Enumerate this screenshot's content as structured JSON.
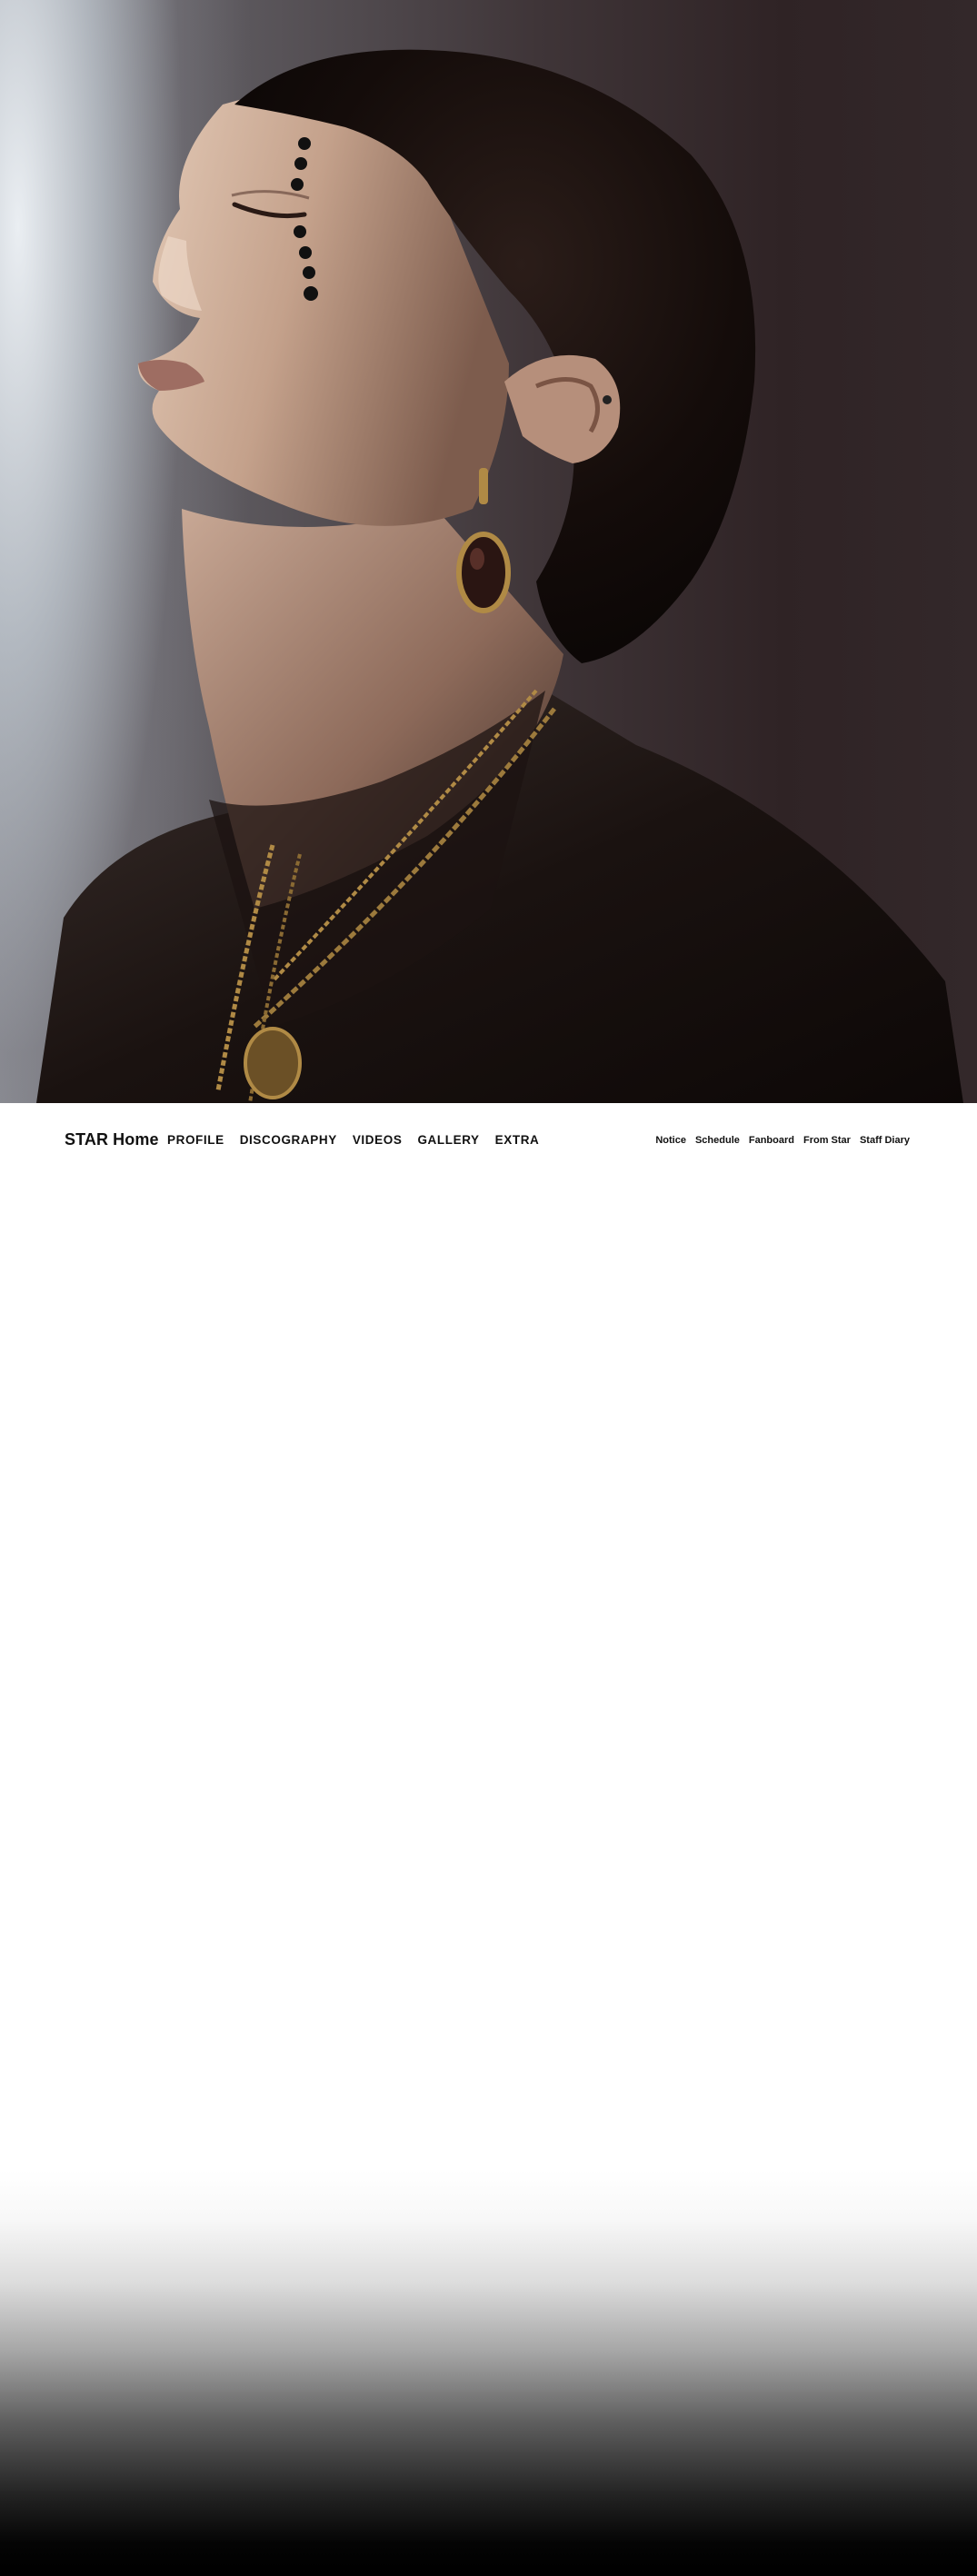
{
  "hero": {
    "photo_icon": "portrait-photo",
    "colors": {
      "backdrop_light": "#e8ecf0",
      "backdrop_dark": "#2f2325",
      "hair": "#120a08",
      "skin": "#c9a892",
      "jacket": "#1a1210",
      "gold": "#b08a45"
    }
  },
  "nav": {
    "brand": "STAR Home",
    "main_menu": [
      "PROFILE",
      "DISCOGRAPHY",
      "VIDEOS",
      "GALLERY",
      "EXTRA"
    ],
    "sub_menu": [
      "Notice",
      "Schedule",
      "Fanboard",
      "From Star",
      "Staff Diary"
    ]
  },
  "footer": {
    "fade_color": "#000000"
  }
}
